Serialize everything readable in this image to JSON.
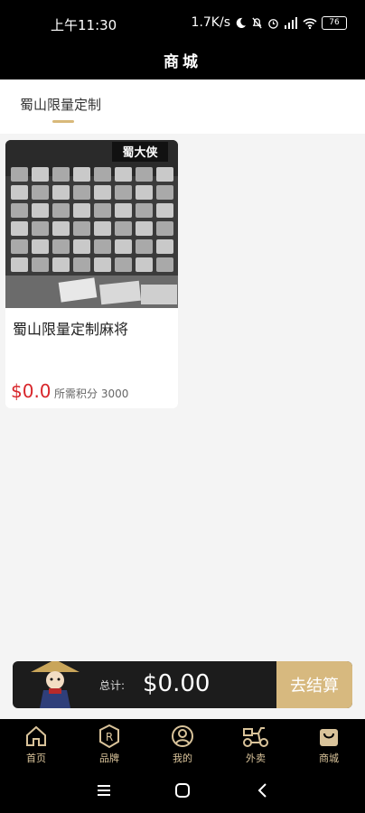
{
  "status_bar": {
    "time": "上午11:30",
    "network_speed": "1.7K/s",
    "battery": "76"
  },
  "header": {
    "title": "商城"
  },
  "tabs": [
    {
      "label": "蜀山限量定制",
      "active": true
    }
  ],
  "products": [
    {
      "name": "蜀山限量定制麻将",
      "price": "$0.0",
      "points_text": "所需积分 3000",
      "image_caption": "蜀大侠"
    }
  ],
  "cart": {
    "total_label": "总计:",
    "total_value": "$0.00",
    "checkout_label": "去结算"
  },
  "bottom_nav": [
    {
      "label": "首页",
      "icon": "home-icon"
    },
    {
      "label": "品牌",
      "icon": "brand-icon"
    },
    {
      "label": "我的",
      "icon": "profile-icon"
    },
    {
      "label": "外卖",
      "icon": "scooter-icon"
    },
    {
      "label": "商城",
      "icon": "shopping-bag-icon"
    }
  ],
  "colors": {
    "accent_gold": "#d7b97f",
    "price_red": "#d8262b",
    "dark": "#1c1c1c"
  }
}
